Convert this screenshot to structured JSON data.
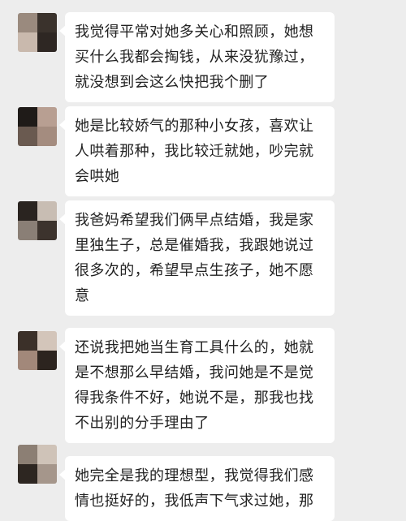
{
  "messages": [
    {
      "text": "我觉得平常对她多关心和照顾，她想买什么我都会掏钱，从来没犹豫过，就没想到会这么快把我个删了",
      "avatar_colors": [
        "#9a8a7e",
        "#3a322c",
        "#c9b9ad",
        "#2e2723"
      ]
    },
    {
      "text": "她是比较娇气的那种小女孩，喜欢让人哄着那种，我比较迁就她，吵完就会哄她",
      "avatar_colors": [
        "#1f1b18",
        "#b89f92",
        "#6a5a50",
        "#a48c7f"
      ]
    },
    {
      "text": "我爸妈希望我们俩早点结婚，我是家里独生子，总是催婚我，我跟她说过很多次的，希望早点生孩子，她不愿意",
      "avatar_colors": [
        "#2a2420",
        "#c8bdb3",
        "#8a7f76",
        "#3c332d"
      ]
    },
    {
      "text": "还说我把她当生育工具什么的，她就是不想那么早结婚，我问她是不是觉得我条件不好，她说不是，那我也找不出别的分手理由了",
      "avatar_colors": [
        "#3b3029",
        "#d3c5ba",
        "#a2887a",
        "#2c241f"
      ]
    },
    {
      "text": "她完全是我的理想型，我觉得我们感情也挺好的，我低声下气求过她，那",
      "avatar_colors": [
        "#8c7f74",
        "#cfc3b8",
        "#2d2621",
        "#a5968b"
      ]
    }
  ]
}
